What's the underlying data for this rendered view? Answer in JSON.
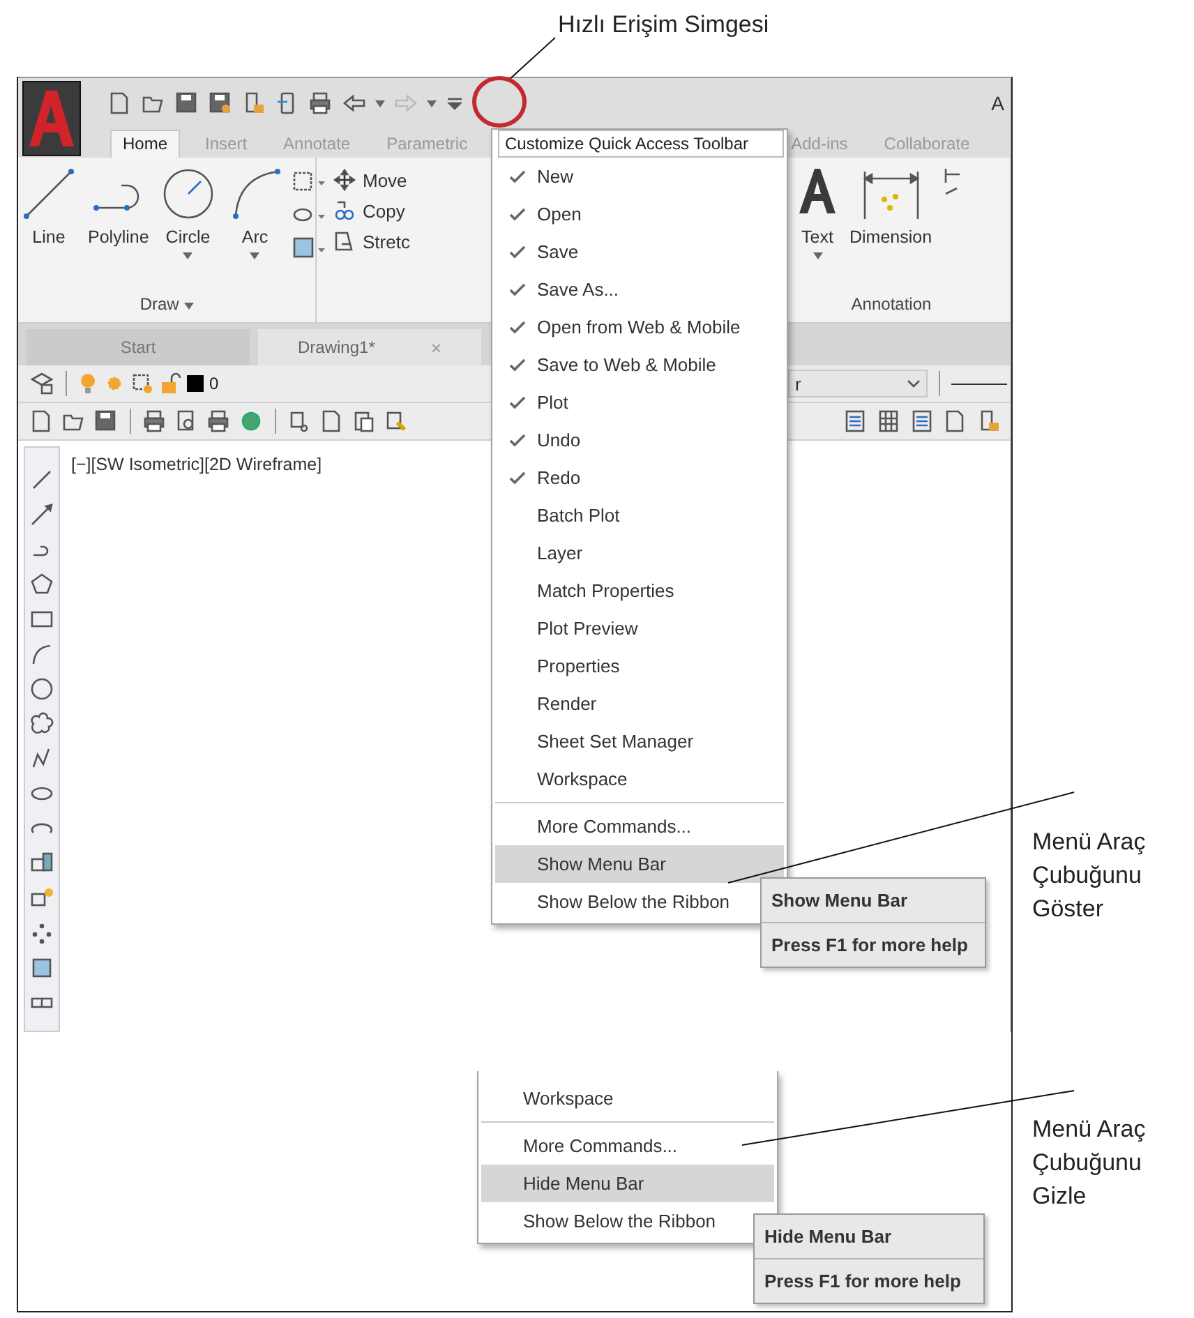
{
  "callouts": [
    {
      "lines": [
        "Hızlı Erişim Simgesi"
      ]
    },
    {
      "lines": [
        "Menü Araç",
        "Çubuğunu",
        "Göster"
      ]
    },
    {
      "lines": [
        "Menü Araç",
        "Çubuğunu",
        "Gizle"
      ]
    }
  ],
  "window": {
    "title": "A"
  },
  "ribbon": {
    "tabs": [
      {
        "label": "Home",
        "selected": true
      },
      {
        "label": "Insert",
        "selected": false
      },
      {
        "label": "Annotate",
        "selected": false
      },
      {
        "label": "Parametric",
        "selected": false
      },
      {
        "label": "Add-ins",
        "selected": false
      },
      {
        "label": "Collaborate",
        "selected": false
      }
    ],
    "draw_tools": [
      "Line",
      "Polyline",
      "Circle",
      "Arc"
    ],
    "draw_panel": "Draw",
    "modify_tools": [
      "Move",
      "Copy",
      "Stretc"
    ],
    "annotation_tools": [
      "Text",
      "Dimension"
    ],
    "annotation_panel": "Annotation"
  },
  "file_tabs": [
    {
      "label": "Start",
      "selected": false
    },
    {
      "label": "Drawing1*",
      "selected": true,
      "close": "×"
    }
  ],
  "layer_toolbar": {
    "layer": "0",
    "linetype": "r"
  },
  "viewport": {
    "label": "[−][SW Isometric][2D Wireframe]"
  },
  "menus": [
    {
      "title": "Customize Quick Access Toolbar",
      "items": [
        {
          "label": "New",
          "checked": true,
          "selected": false
        },
        {
          "label": "Open",
          "checked": true,
          "selected": false
        },
        {
          "label": "Save",
          "checked": true,
          "selected": false
        },
        {
          "label": "Save As...",
          "checked": true,
          "selected": false
        },
        {
          "label": "Open from Web & Mobile",
          "checked": true,
          "selected": false
        },
        {
          "label": "Save to Web & Mobile",
          "checked": true,
          "selected": false
        },
        {
          "label": "Plot",
          "checked": true,
          "selected": false
        },
        {
          "label": "Undo",
          "checked": true,
          "selected": false
        },
        {
          "label": "Redo",
          "checked": true,
          "selected": false
        },
        {
          "label": "Batch Plot",
          "checked": false,
          "selected": false
        },
        {
          "label": "Layer",
          "checked": false,
          "selected": false
        },
        {
          "label": "Match Properties",
          "checked": false,
          "selected": false
        },
        {
          "label": "Plot Preview",
          "checked": false,
          "selected": false
        },
        {
          "label": "Properties",
          "checked": false,
          "selected": false
        },
        {
          "label": "Render",
          "checked": false,
          "selected": false
        },
        {
          "label": "Sheet Set Manager",
          "checked": false,
          "selected": false
        },
        {
          "label": "Workspace",
          "checked": false,
          "selected": false
        },
        {
          "label": "More Commands...",
          "checked": false,
          "selected": false,
          "divider_before": true
        },
        {
          "label": "Show Menu Bar",
          "checked": false,
          "selected": true
        },
        {
          "label": "Show Below the Ribbon",
          "checked": false,
          "selected": false
        }
      ]
    },
    {
      "items": [
        {
          "label": "Workspace",
          "selected": false
        },
        {
          "label": "More Commands...",
          "selected": false,
          "divider_before": true
        },
        {
          "label": "Hide Menu Bar",
          "selected": true
        },
        {
          "label": "Show Below the Ribbon",
          "selected": false
        }
      ]
    }
  ],
  "tooltips": [
    {
      "title": "Show Menu Bar",
      "help": "Press F1 for more help"
    },
    {
      "title": "Hide Menu Bar",
      "help": "Press F1 for more help"
    }
  ]
}
